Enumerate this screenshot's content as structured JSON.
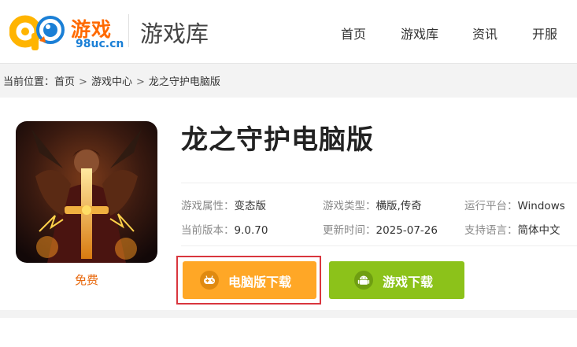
{
  "header": {
    "logo_text": "游戏",
    "logo_url": "98uc.cn",
    "section_title": "游戏库",
    "nav": [
      "首页",
      "游戏库",
      "资讯",
      "开服"
    ]
  },
  "breadcrumb": {
    "prefix": "当前位置：",
    "items": [
      "首页",
      "游戏中心",
      "龙之守护电脑版"
    ],
    "separator": ">"
  },
  "game": {
    "title": "龙之守护电脑版",
    "price": "免费",
    "attributes": [
      {
        "label": "游戏属性：",
        "value": "变态版"
      },
      {
        "label": "游戏类型：",
        "value": "横版,传奇"
      },
      {
        "label": "运行平台：",
        "value": "Windows"
      },
      {
        "label": "当前版本：",
        "value": "9.0.70"
      },
      {
        "label": "更新时间：",
        "value": "2025-07-26"
      },
      {
        "label": "支持语言：",
        "value": "简体中文"
      }
    ],
    "buttons": {
      "pc_download": "电脑版下载",
      "game_download": "游戏下载"
    }
  },
  "colors": {
    "pc_button": "#ffa726",
    "android_button": "#8cc21a",
    "highlight_frame": "#d9363e",
    "price": "#e86a10"
  },
  "icons": {
    "pc_button_icon": "gamepad-icon",
    "android_button_icon": "android-icon"
  }
}
